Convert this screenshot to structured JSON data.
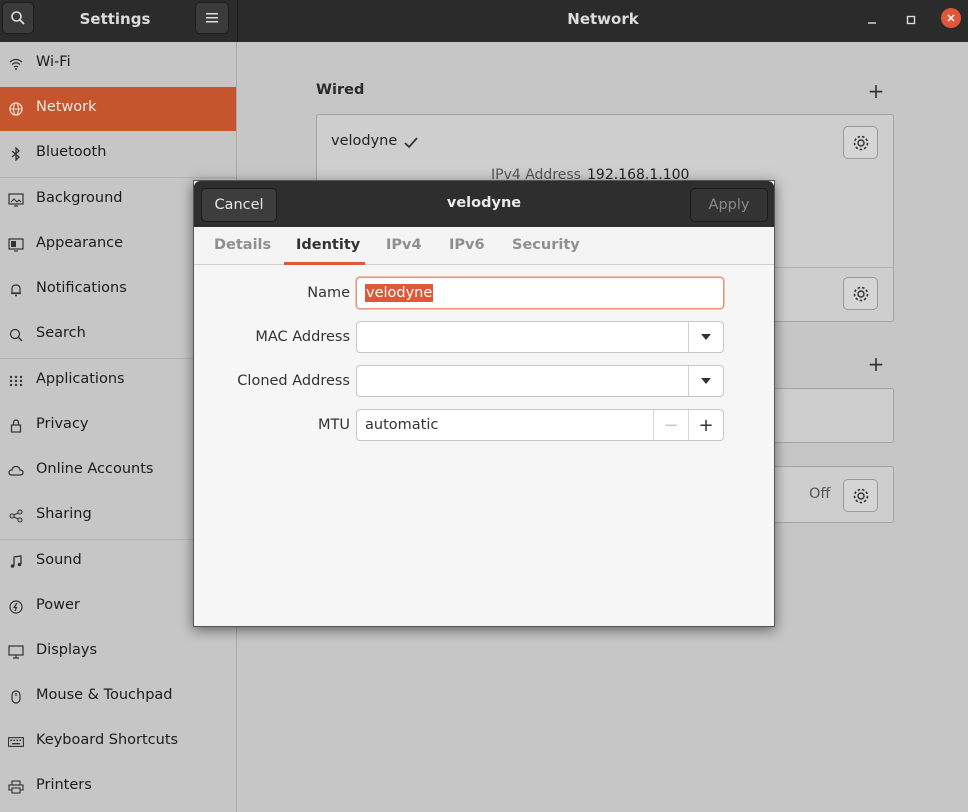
{
  "header": {
    "left_title": "Settings",
    "main_title": "Network"
  },
  "sidebar": {
    "items": [
      {
        "label": "Wi-Fi",
        "icon": "wifi-icon"
      },
      {
        "label": "Network",
        "icon": "network-icon",
        "active": true
      },
      {
        "label": "Bluetooth",
        "icon": "bluetooth-icon"
      },
      {
        "label": "Background",
        "icon": "background-icon"
      },
      {
        "label": "Appearance",
        "icon": "appearance-icon"
      },
      {
        "label": "Notifications",
        "icon": "bell-icon"
      },
      {
        "label": "Search",
        "icon": "search-icon"
      },
      {
        "label": "Applications",
        "icon": "grid-icon"
      },
      {
        "label": "Privacy",
        "icon": "lock-icon"
      },
      {
        "label": "Online Accounts",
        "icon": "cloud-icon"
      },
      {
        "label": "Sharing",
        "icon": "share-icon"
      },
      {
        "label": "Sound",
        "icon": "music-icon"
      },
      {
        "label": "Power",
        "icon": "power-icon"
      },
      {
        "label": "Displays",
        "icon": "display-icon"
      },
      {
        "label": "Mouse & Touchpad",
        "icon": "mouse-icon"
      },
      {
        "label": "Keyboard Shortcuts",
        "icon": "keyboard-icon"
      },
      {
        "label": "Printers",
        "icon": "printer-icon"
      }
    ]
  },
  "main": {
    "wired_title": "Wired",
    "connection_name": "velodyne",
    "ipv4_label": "IPv4 Address",
    "ipv4_value": "192.168.1.100",
    "off_label": "Off"
  },
  "dialog": {
    "title": "velodyne",
    "cancel_label": "Cancel",
    "apply_label": "Apply",
    "tabs": [
      "Details",
      "Identity",
      "IPv4",
      "IPv6",
      "Security"
    ],
    "active_tab": "Identity",
    "fields": {
      "name_label": "Name",
      "name_value": "velodyne",
      "mac_label": "MAC Address",
      "mac_value": "",
      "cloned_label": "Cloned Address",
      "cloned_value": "",
      "mtu_label": "MTU",
      "mtu_value": "automatic"
    }
  },
  "colors": {
    "accent": "#e0583a",
    "header_bg": "#2b2b2b",
    "sidebar_active": "#c4552d"
  }
}
